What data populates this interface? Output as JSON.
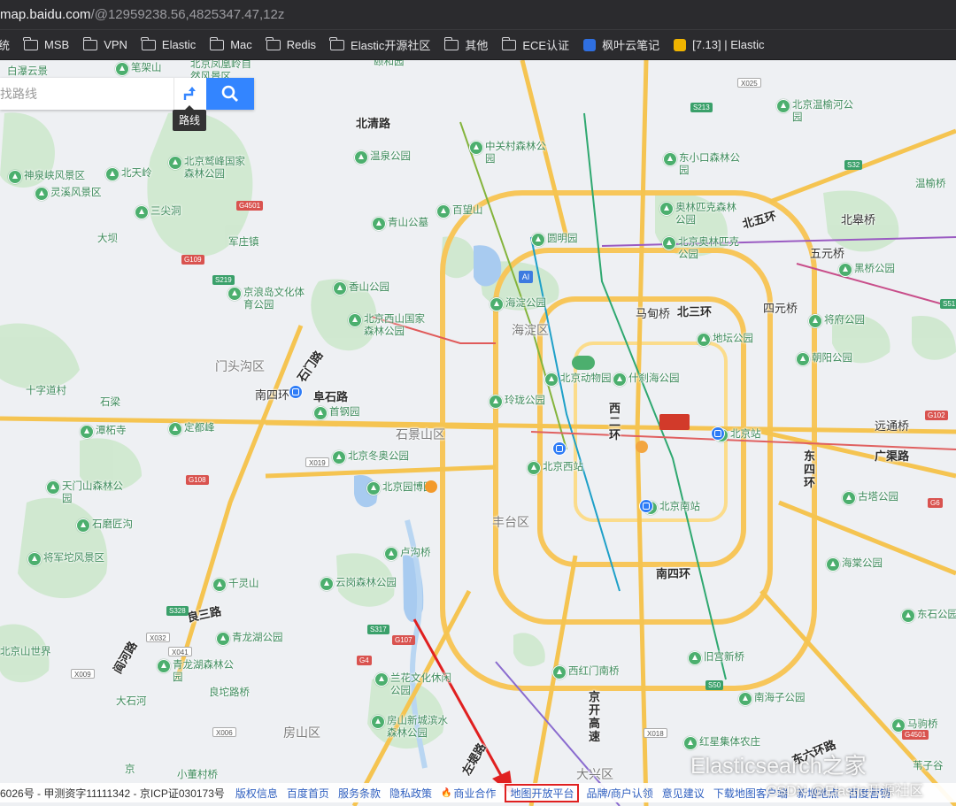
{
  "browser": {
    "url_host": "map.baidu.com",
    "url_rest": "/@12959238.56,4825347.47,12z"
  },
  "bookmarks": [
    {
      "label": "统",
      "type": "cut"
    },
    {
      "label": "MSB",
      "type": "folder"
    },
    {
      "label": "VPN",
      "type": "folder"
    },
    {
      "label": "Elastic",
      "type": "folder"
    },
    {
      "label": "Mac",
      "type": "folder"
    },
    {
      "label": "Redis",
      "type": "folder"
    },
    {
      "label": "Elastic开源社区",
      "type": "folder"
    },
    {
      "label": "其他",
      "type": "folder"
    },
    {
      "label": "ECE认证",
      "type": "folder"
    },
    {
      "label": "枫叶云笔记",
      "type": "app",
      "color": "#2f6fe0"
    },
    {
      "label": "[7.13] | Elastic",
      "type": "app",
      "color": "#f0b400"
    }
  ],
  "search": {
    "placeholder": "找路线",
    "route_tooltip": "路线"
  },
  "map": {
    "districts": [
      "门头沟区",
      "石景山区",
      "海淀区",
      "丰台区",
      "房山区",
      "大兴区"
    ],
    "roads": [
      "北清路",
      "北五环",
      "北三环",
      "四元桥",
      "马甸桥",
      "南四环",
      "西二环",
      "东四环",
      "广渠路",
      "京开高速",
      "阜石路",
      "石门路",
      "良三路",
      "阎河路",
      "左堤路",
      "东六环路",
      "西二环",
      "远通桥",
      "五元桥",
      "北皋桥",
      "南四环"
    ],
    "places": [
      {
        "name": "白瀑云景"
      },
      {
        "name": "笔架山"
      },
      {
        "name": "北京凤凰岭自然风景区"
      },
      {
        "name": "颐和园"
      },
      {
        "name": "神泉峡风景区"
      },
      {
        "name": "北天岭"
      },
      {
        "name": "北京鹫峰国家森林公园"
      },
      {
        "name": "灵溪风景区"
      },
      {
        "name": "三尖洞"
      },
      {
        "name": "温泉公园"
      },
      {
        "name": "中关村森林公园"
      },
      {
        "name": "百望山"
      },
      {
        "name": "青山公墓"
      },
      {
        "name": "圆明园"
      },
      {
        "name": "海淀公园"
      },
      {
        "name": "香山公园"
      },
      {
        "name": "北京西山国家森林公园"
      },
      {
        "name": "京浪岛文化体育公园"
      },
      {
        "name": "军庄镇"
      },
      {
        "name": "大坝"
      },
      {
        "name": "北京温榆河公园"
      },
      {
        "name": "东小口森林公园"
      },
      {
        "name": "奥林匹克森林公园"
      },
      {
        "name": "北京奥林匹克公园"
      },
      {
        "name": "黑桥公园"
      },
      {
        "name": "将府公园"
      },
      {
        "name": "地坛公园"
      },
      {
        "name": "朝阳公园"
      },
      {
        "name": "北京动物园"
      },
      {
        "name": "什刹海公园"
      },
      {
        "name": "玲珑公园"
      },
      {
        "name": "首钢园"
      },
      {
        "name": "北京冬奥公园"
      },
      {
        "name": "北京西站"
      },
      {
        "name": "北京站"
      },
      {
        "name": "北京南站"
      },
      {
        "name": "北京园博园"
      },
      {
        "name": "卢沟桥"
      },
      {
        "name": "云岗森林公园"
      },
      {
        "name": "青龙湖公园"
      },
      {
        "name": "青龙湖森林公园"
      },
      {
        "name": "千灵山"
      },
      {
        "name": "天门山森林公园"
      },
      {
        "name": "石磨匠沟"
      },
      {
        "name": "将军坨风景区"
      },
      {
        "name": "潭柘寺"
      },
      {
        "name": "定都峰"
      },
      {
        "name": "兰花文化休闲公园"
      },
      {
        "name": "房山新城滨水森林公园"
      },
      {
        "name": "西红门南桥"
      },
      {
        "name": "旧宫新桥"
      },
      {
        "name": "南海子公园"
      },
      {
        "name": "红星集体农庄"
      },
      {
        "name": "东石公园"
      },
      {
        "name": "古塔公园"
      },
      {
        "name": "海棠公园"
      },
      {
        "name": "马驹桥"
      },
      {
        "name": "温榆桥"
      },
      {
        "name": "北京山世界"
      },
      {
        "name": "十字道村"
      },
      {
        "name": "石梁"
      },
      {
        "name": "小董村桥"
      },
      {
        "name": "良坨路桥"
      },
      {
        "name": "大石河"
      },
      {
        "name": "京"
      },
      {
        "name": "门头沟区"
      },
      {
        "name": "苇子谷"
      },
      {
        "name": "东六环路"
      }
    ],
    "shields": [
      "G4501",
      "G6",
      "G108",
      "X019",
      "G109",
      "S219",
      "S328",
      "X032",
      "X041",
      "X009",
      "G107",
      "S317",
      "G4",
      "X006",
      "S50",
      "X018",
      "G4501",
      "G102",
      "S32",
      "S51",
      "X025",
      "S213"
    ],
    "poi_labels": [
      "AI"
    ]
  },
  "footer": {
    "copyright": "6026号 - 甲测资字11111342 - 京ICP证030173号",
    "links": [
      {
        "label": "版权信息"
      },
      {
        "label": "百度首页"
      },
      {
        "label": "服务条款"
      },
      {
        "label": "隐私政策"
      },
      {
        "label": "商业合作"
      },
      {
        "label": "地图开放平台",
        "highlight": true
      },
      {
        "label": "品牌/商户认领"
      },
      {
        "label": "意见建议"
      },
      {
        "label": "下载地图客户端"
      },
      {
        "label": "新增地点"
      },
      {
        "label": "百度营销"
      }
    ]
  },
  "watermark": {
    "title": "Elasticsearch之家",
    "subtitle": "CSDN @Elastic开源社区"
  },
  "colors": {
    "accent": "#3385ff",
    "arrow": "#e02020",
    "road_major": "#f5c451",
    "road_ring": "#fad26a",
    "park": "#c6e6c9"
  }
}
